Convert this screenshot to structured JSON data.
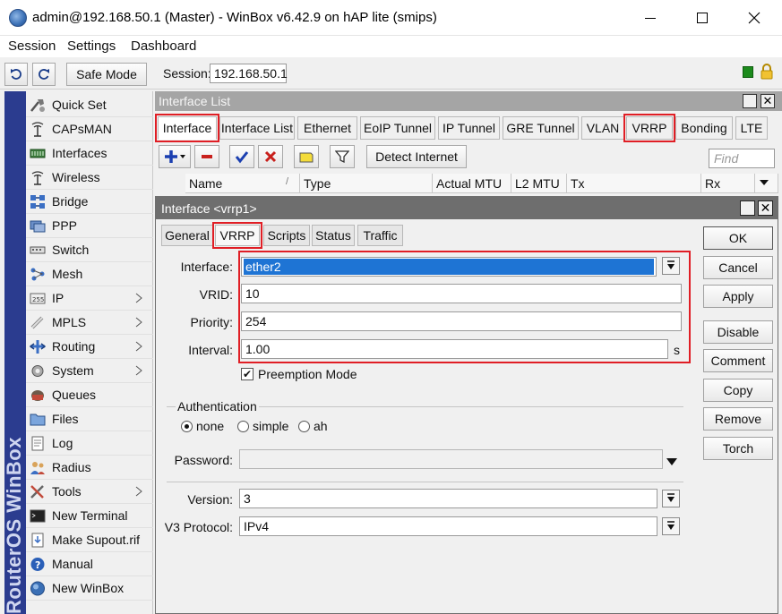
{
  "window": {
    "title": "admin@192.168.50.1 (Master) - WinBox v6.42.9 on hAP lite (smips)",
    "min": "—",
    "max": "☐",
    "close": "✕"
  },
  "menu": [
    "Session",
    "Settings",
    "Dashboard"
  ],
  "toolbar": {
    "undo": "↶",
    "redo": "↷",
    "safe_mode": "Safe Mode",
    "session_label": "Session:",
    "session_value": "192.168.50.1"
  },
  "brand": "RouterOS WinBox",
  "sidebar": {
    "items": [
      {
        "label": "Quick Set",
        "icon": "quick-set-icon",
        "submenu": false
      },
      {
        "label": "CAPsMAN",
        "icon": "capsman-icon",
        "submenu": false
      },
      {
        "label": "Interfaces",
        "icon": "interfaces-icon",
        "submenu": false
      },
      {
        "label": "Wireless",
        "icon": "wireless-icon",
        "submenu": false
      },
      {
        "label": "Bridge",
        "icon": "bridge-icon",
        "submenu": false
      },
      {
        "label": "PPP",
        "icon": "ppp-icon",
        "submenu": false
      },
      {
        "label": "Switch",
        "icon": "switch-icon",
        "submenu": false
      },
      {
        "label": "Mesh",
        "icon": "mesh-icon",
        "submenu": false
      },
      {
        "label": "IP",
        "icon": "ip-icon",
        "submenu": true
      },
      {
        "label": "MPLS",
        "icon": "mpls-icon",
        "submenu": true
      },
      {
        "label": "Routing",
        "icon": "routing-icon",
        "submenu": true
      },
      {
        "label": "System",
        "icon": "system-icon",
        "submenu": true
      },
      {
        "label": "Queues",
        "icon": "queues-icon",
        "submenu": false
      },
      {
        "label": "Files",
        "icon": "files-icon",
        "submenu": false
      },
      {
        "label": "Log",
        "icon": "log-icon",
        "submenu": false
      },
      {
        "label": "Radius",
        "icon": "radius-icon",
        "submenu": false
      },
      {
        "label": "Tools",
        "icon": "tools-icon",
        "submenu": true
      },
      {
        "label": "New Terminal",
        "icon": "terminal-icon",
        "submenu": false
      },
      {
        "label": "Make Supout.rif",
        "icon": "supout-icon",
        "submenu": false
      },
      {
        "label": "Manual",
        "icon": "manual-icon",
        "submenu": false
      },
      {
        "label": "New WinBox",
        "icon": "winbox-icon",
        "submenu": false
      }
    ]
  },
  "interface_list": {
    "title": "Interface List",
    "tabs": [
      "Interface",
      "Interface List",
      "Ethernet",
      "EoIP Tunnel",
      "IP Tunnel",
      "GRE Tunnel",
      "VLAN",
      "VRRP",
      "Bonding",
      "LTE"
    ],
    "detect_internet": "Detect Internet",
    "find_placeholder": "Find",
    "columns": [
      "Name",
      "Type",
      "Actual MTU",
      "L2 MTU",
      "Tx",
      "Rx"
    ]
  },
  "dialog": {
    "title": "Interface <vrrp1>",
    "tabs": [
      "General",
      "VRRP",
      "Scripts",
      "Status",
      "Traffic"
    ],
    "fields": {
      "interface_label": "Interface:",
      "interface_value": "ether2",
      "vrid_label": "VRID:",
      "vrid_value": "10",
      "priority_label": "Priority:",
      "priority_value": "254",
      "interval_label": "Interval:",
      "interval_value": "1.00",
      "interval_unit": "s",
      "preemption_label": "Preemption Mode",
      "authentication_label": "Authentication",
      "auth_none": "none",
      "auth_simple": "simple",
      "auth_ah": "ah",
      "password_label": "Password:",
      "password_value": "",
      "version_label": "Version:",
      "version_value": "3",
      "v3_protocol_label": "V3 Protocol:",
      "v3_protocol_value": "IPv4"
    },
    "buttons": [
      "OK",
      "Cancel",
      "Apply",
      "Disable",
      "Comment",
      "Copy",
      "Remove",
      "Torch"
    ],
    "dd_glyph": "▼"
  }
}
